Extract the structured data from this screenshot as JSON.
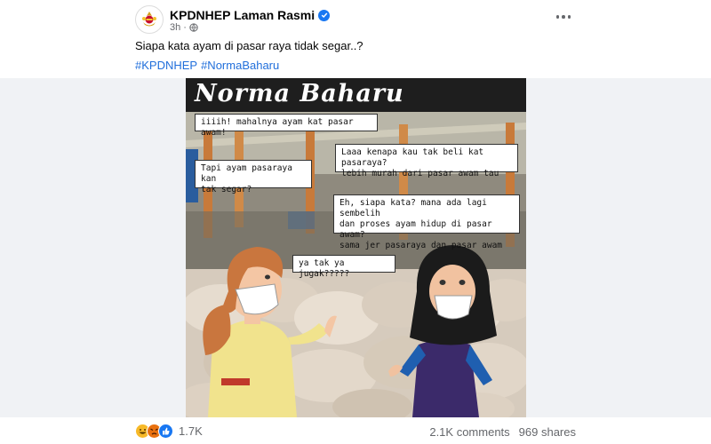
{
  "post": {
    "page_name": "KPDNHEP Laman Rasmi",
    "time": "3h",
    "audience_icon": "globe-icon",
    "caption": "Siapa kata ayam di pasar raya tidak segar..?",
    "hashtags": [
      "#KPDNHEP",
      "#NormaBaharu"
    ]
  },
  "image": {
    "title": "Norma Baharu",
    "bubbles": [
      "iiiih! mahalnya ayam kat pasar awam!",
      "Tapi ayam pasaraya kan\ntak segar?",
      "Laaa kenapa kau tak beli kat pasaraya?\nlebih murah dari pasar awam tau",
      "Eh, siapa kata? mana ada lagi sembelih\ndan proses ayam hidup di pasar awam?\nsama jer pasaraya dan pasar awam",
      "ya tak ya jugak?????"
    ]
  },
  "footer": {
    "reactions": [
      "haha",
      "angry",
      "like"
    ],
    "reaction_count": "1.7K",
    "comments": "2.1K comments",
    "shares": "969 shares"
  },
  "colors": {
    "link": "#216fdb",
    "verified": "#1877f2",
    "muted": "#65676b"
  }
}
